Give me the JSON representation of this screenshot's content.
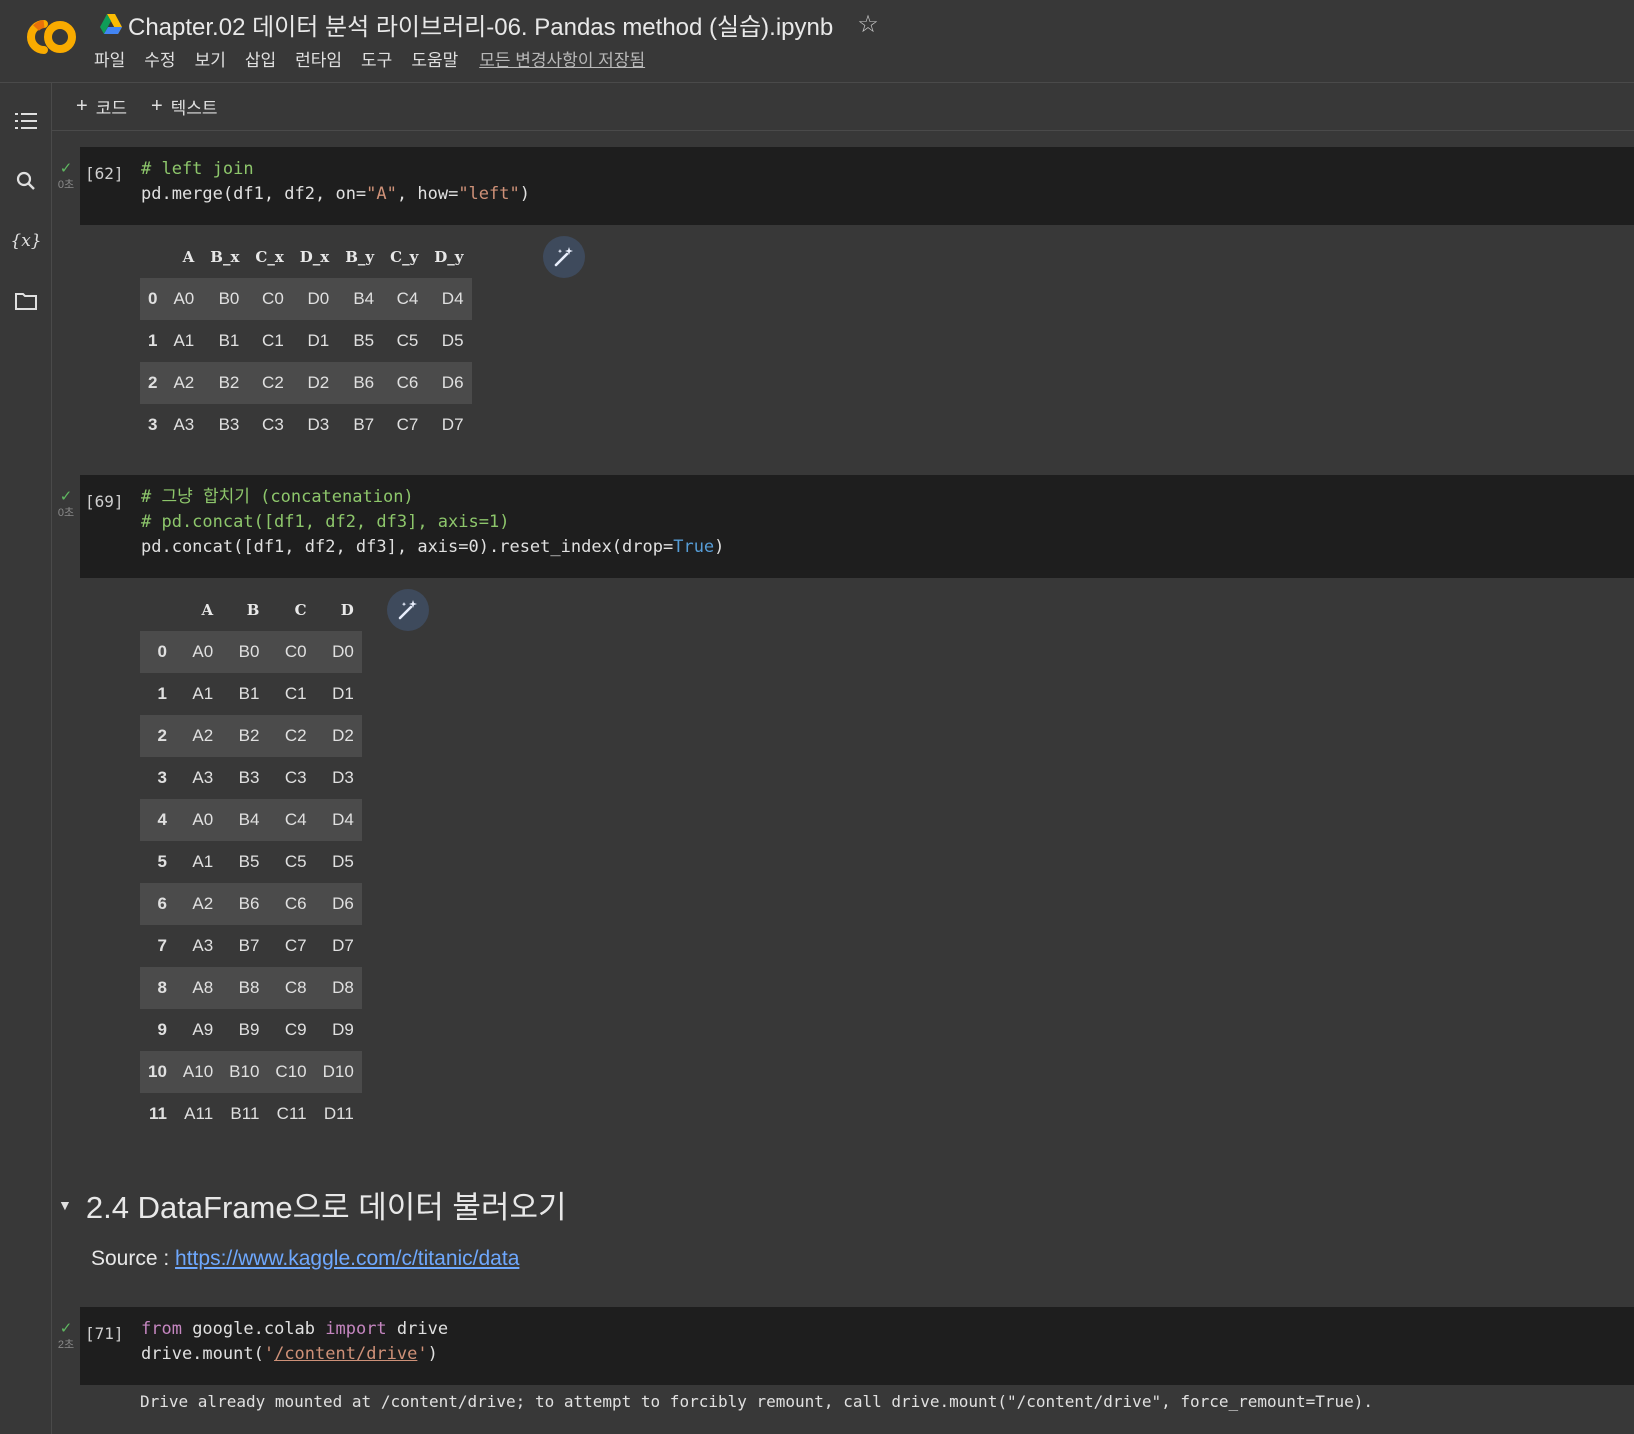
{
  "app": {
    "title": "Chapter.02 데이터 분석 라이브러리-06. Pandas method (실습).ipynb",
    "menu": [
      "파일",
      "수정",
      "보기",
      "삽입",
      "런타임",
      "도구",
      "도움말"
    ],
    "saved_status": "모든 변경사항이 저장됨"
  },
  "toolbar": {
    "add_code": "코드",
    "add_text": "텍스트"
  },
  "cells": {
    "c62": {
      "exec": "[62]",
      "time": "0초",
      "line1": "# left join",
      "line2_a": "pd.merge(df1, df2, on=",
      "line2_b": "\"A\"",
      "line2_c": ", how=",
      "line2_d": "\"left\"",
      "line2_e": ")"
    },
    "c69": {
      "exec": "[69]",
      "time": "0초",
      "line1": "# 그냥 합치기 (concatenation)",
      "line2": "# pd.concat([df1, df2, df3], axis=1)",
      "line3_a": "pd.concat([df1, df2, df3], axis=0).reset_index(drop=",
      "line3_b": "True",
      "line3_c": ")"
    },
    "c71": {
      "exec": "[71]",
      "time": "2초",
      "line1_a": "from",
      "line1_b": " google.colab ",
      "line1_c": "import",
      "line1_d": " drive",
      "line2_a": "drive.mount(",
      "line2_b": "'",
      "line2_c": "/content/drive",
      "line2_d": "'",
      "line2_e": ")",
      "output": "Drive already mounted at /content/drive; to attempt to forcibly remount, call drive.mount(\"/content/drive\", force_remount=True)."
    }
  },
  "table1": {
    "columns": [
      "",
      "A",
      "B_x",
      "C_x",
      "D_x",
      "B_y",
      "C_y",
      "D_y"
    ],
    "rows": [
      [
        "0",
        "A0",
        "B0",
        "C0",
        "D0",
        "B4",
        "C4",
        "D4"
      ],
      [
        "1",
        "A1",
        "B1",
        "C1",
        "D1",
        "B5",
        "C5",
        "D5"
      ],
      [
        "2",
        "A2",
        "B2",
        "C2",
        "D2",
        "B6",
        "C6",
        "D6"
      ],
      [
        "3",
        "A3",
        "B3",
        "C3",
        "D3",
        "B7",
        "C7",
        "D7"
      ]
    ]
  },
  "table2": {
    "columns": [
      "",
      "A",
      "B",
      "C",
      "D"
    ],
    "rows": [
      [
        "0",
        "A0",
        "B0",
        "C0",
        "D0"
      ],
      [
        "1",
        "A1",
        "B1",
        "C1",
        "D1"
      ],
      [
        "2",
        "A2",
        "B2",
        "C2",
        "D2"
      ],
      [
        "3",
        "A3",
        "B3",
        "C3",
        "D3"
      ],
      [
        "4",
        "A0",
        "B4",
        "C4",
        "D4"
      ],
      [
        "5",
        "A1",
        "B5",
        "C5",
        "D5"
      ],
      [
        "6",
        "A2",
        "B6",
        "C6",
        "D6"
      ],
      [
        "7",
        "A3",
        "B7",
        "C7",
        "D7"
      ],
      [
        "8",
        "A8",
        "B8",
        "C8",
        "D8"
      ],
      [
        "9",
        "A9",
        "B9",
        "C9",
        "D9"
      ],
      [
        "10",
        "A10",
        "B10",
        "C10",
        "D10"
      ],
      [
        "11",
        "A11",
        "B11",
        "C11",
        "D11"
      ]
    ]
  },
  "section": {
    "title": "2.4 DataFrame으로 데이터 불러오기",
    "source_label": "Source : ",
    "source_link": "https://www.kaggle.com/c/titanic/data"
  },
  "colors": {
    "background": "#383838",
    "code_bg": "#1e1e1e",
    "link": "#6ea8fe",
    "check": "#5fb760"
  }
}
